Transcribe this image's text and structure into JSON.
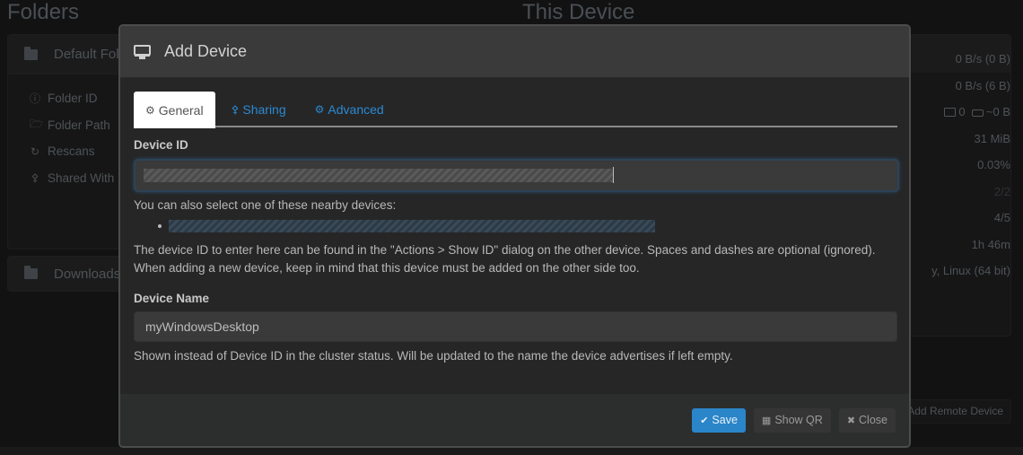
{
  "background": {
    "folders_title": "Folders",
    "device_title": "This Device",
    "folders": [
      {
        "name": "Default Folder",
        "properties": [
          {
            "icon": "info-circle-icon",
            "label": "Folder ID"
          },
          {
            "icon": "folder-open-icon",
            "label": "Folder Path"
          },
          {
            "icon": "refresh-icon",
            "label": "Rescans"
          },
          {
            "icon": "share-icon",
            "label": "Shared With"
          }
        ]
      },
      {
        "name": "Downloads"
      }
    ],
    "this_device": {
      "download_rate": "0 B/s (0 B)",
      "upload_rate": "0 B/s (6 B)",
      "local_folders": "0",
      "local_state": "~0 B",
      "ram": "31 MiB",
      "cpu": "0.03%",
      "listeners": "2/2",
      "discovery": "4/5",
      "uptime": "1h 46m",
      "version": "y, Linux (64 bit)"
    },
    "add_remote_device": "Add Remote Device"
  },
  "modal": {
    "title": "Add Device",
    "title_icon": "desktop-icon",
    "tabs": [
      {
        "label": "General",
        "icon": "gear-icon",
        "active": true
      },
      {
        "label": "Sharing",
        "icon": "share-icon",
        "active": false
      },
      {
        "label": "Advanced",
        "icon": "gears-icon",
        "active": false
      }
    ],
    "device_id_label": "Device ID",
    "device_id_value": "[redacted]",
    "nearby_text": "You can also select one of these nearby devices:",
    "nearby_devices": [
      "[redacted]"
    ],
    "device_id_help_1": "The device ID to enter here can be found in the \"Actions > Show ID\" dialog on the other device. Spaces and dashes are optional (ignored).",
    "device_id_help_2": "When adding a new device, keep in mind that this device must be added on the other side too.",
    "device_name_label": "Device Name",
    "device_name_value": "myWindowsDesktop",
    "device_name_help": "Shown instead of Device ID in the cluster status. Will be updated to the name the device advertises if left empty.",
    "buttons": {
      "save": "Save",
      "show_qr": "Show QR",
      "close": "Close"
    }
  },
  "colors": {
    "primary": "#2a85c9",
    "tab_link": "#2a8ad4",
    "page_bg": "#121212",
    "modal_bg": "#262626"
  }
}
